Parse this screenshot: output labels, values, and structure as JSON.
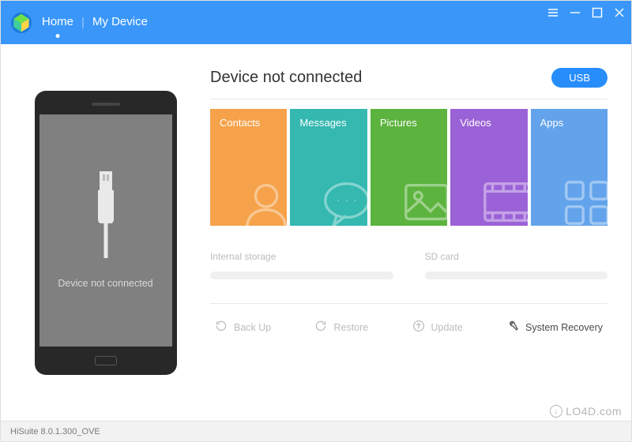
{
  "header": {
    "nav": {
      "home": "Home",
      "my_device": "My Device"
    }
  },
  "main": {
    "heading": "Device not connected",
    "usb_button": "USB",
    "phone_status": "Device not connected",
    "tiles": {
      "contacts": {
        "label": "Contacts",
        "color": "#f5a24a"
      },
      "messages": {
        "label": "Messages",
        "color": "#34b8b0"
      },
      "pictures": {
        "label": "Pictures",
        "color": "#5cb33e"
      },
      "videos": {
        "label": "Videos",
        "color": "#9b62d7"
      },
      "apps": {
        "label": "Apps",
        "color": "#63a3eb"
      }
    },
    "storage": {
      "internal_label": "Internal storage",
      "sd_label": "SD card"
    },
    "actions": {
      "backup": "Back Up",
      "restore": "Restore",
      "update": "Update",
      "recovery": "System Recovery"
    }
  },
  "status": {
    "version": "HiSuite 8.0.1.300_OVE"
  },
  "watermark": "LO4D.com"
}
